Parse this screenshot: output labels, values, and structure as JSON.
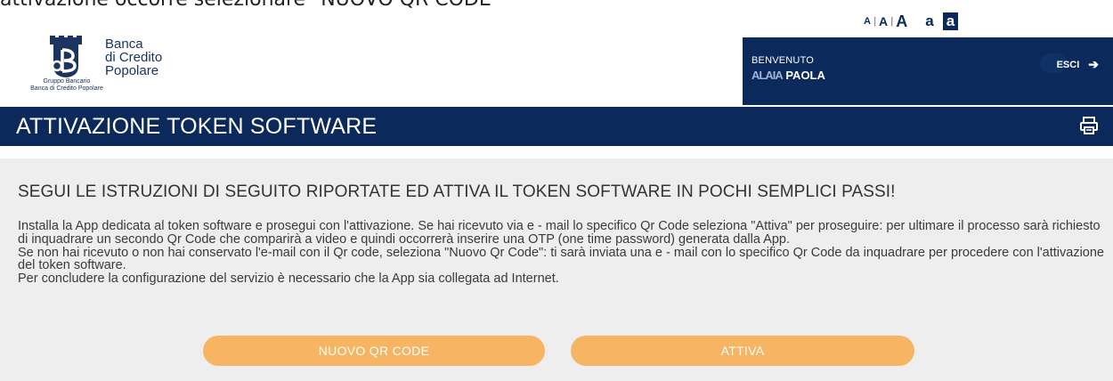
{
  "top_caption": "attivazione occorre selezionare \"NUOVO QR CODE\"",
  "font_controls": {
    "small": "A",
    "medium": "A",
    "large": "A",
    "separator": "|",
    "contrast_normal": "a",
    "contrast_inverted": "a"
  },
  "logo": {
    "line1": "Banca",
    "line2": "di Credito",
    "line3": "Popolare",
    "sub1": "Gruppo Bancario",
    "sub2": "Banca di Credito Popolare"
  },
  "user": {
    "welcome": "BENVENUTO",
    "name_redacted": "ALAIA",
    "name": "PAOLA",
    "logout": "ESCI",
    "logout_icon": "arrow-right-icon"
  },
  "page": {
    "title": "ATTIVAZIONE TOKEN SOFTWARE",
    "print_icon": "print-icon"
  },
  "content": {
    "heading": "SEGUI LE ISTRUZIONI DI SEGUITO RIPORTATE ED ATTIVA IL TOKEN SOFTWARE IN POCHI SEMPLICI PASSI!",
    "paragraph1": "Installa la App dedicata al token software e prosegui con l'attivazione. Se hai ricevuto via e - mail lo specifico Qr Code seleziona \"Attiva\" per proseguire: per ultimare il processo sarà richiesto di inquadrare un secondo Qr Code che comparirà a video e quindi occorrerà inserire una OTP (one time password) generata dalla App.",
    "paragraph2": "Se non hai ricevuto o non hai conservato l'e-mail con il Qr code, seleziona \"Nuovo Qr Code\": ti sarà inviata una e - mail con lo specifico Qr Code da inquadrare per procedere con l'attivazione del token software.",
    "paragraph3": "Per concludere la configurazione del servizio è necessario che la App sia collegata ad Internet."
  },
  "buttons": {
    "new_qr": "NUOVO QR CODE",
    "activate": "ATTIVA"
  },
  "colors": {
    "navy": "#0b2a5b",
    "content_bg": "#eeeeee",
    "button_orange": "#f7b563"
  }
}
